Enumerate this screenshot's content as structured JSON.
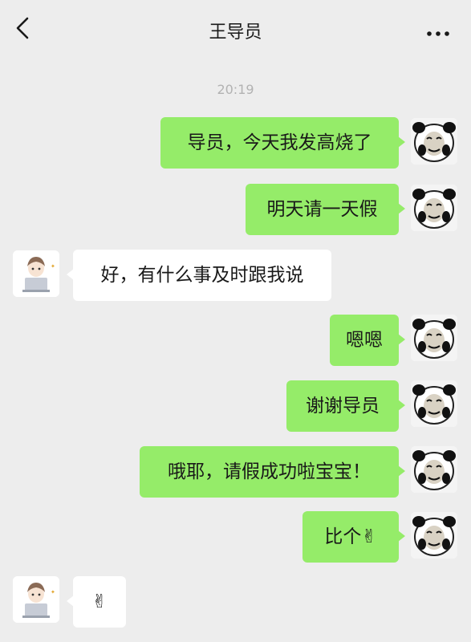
{
  "header": {
    "title": "王导员",
    "back_icon": "chevron-left-icon",
    "more_icon": "more-dots-icon"
  },
  "timestamp": "20:19",
  "messages": [
    {
      "sender": "me",
      "text": "导员，今天我发高烧了"
    },
    {
      "sender": "me",
      "text": "明天请一天假"
    },
    {
      "sender": "them",
      "text": "好，有什么事及时跟我说"
    },
    {
      "sender": "me",
      "text": "嗯嗯"
    },
    {
      "sender": "me",
      "text": "谢谢导员"
    },
    {
      "sender": "me",
      "text": "哦耶，请假成功啦宝宝！"
    },
    {
      "sender": "me",
      "text": "比个✌"
    },
    {
      "sender": "them",
      "text": "✌"
    }
  ],
  "colors": {
    "background": "#ededed",
    "my_bubble": "#95ec69",
    "their_bubble": "#ffffff"
  },
  "avatars": {
    "me": "panda-meme-avatar",
    "them": "boy-laptop-avatar"
  }
}
